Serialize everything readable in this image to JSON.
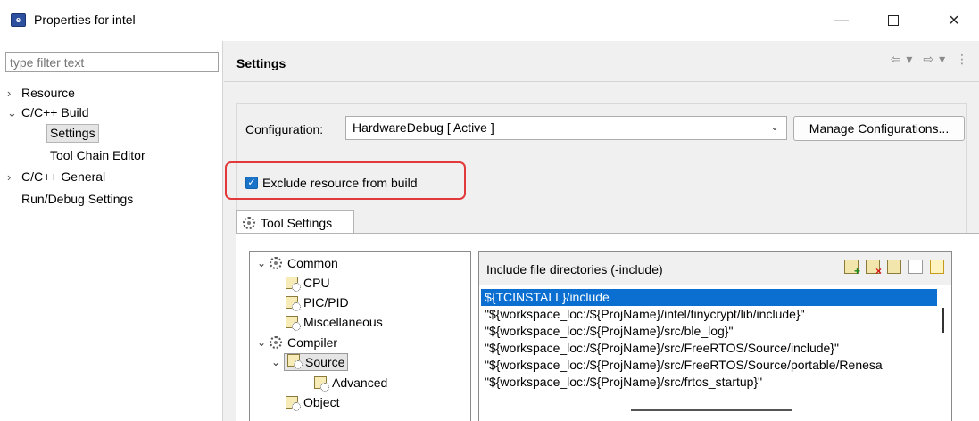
{
  "window": {
    "title": "Properties for intel",
    "icon_label": "e",
    "icon_name": "eclipse-app-icon"
  },
  "sidebar": {
    "filter_placeholder": "type filter text",
    "items": [
      {
        "label": "Resource",
        "arrow": "›",
        "expanded": false
      },
      {
        "label": "C/C++ Build",
        "arrow": "⌄",
        "expanded": true
      },
      {
        "label": "Settings",
        "selected": true
      },
      {
        "label": "Tool Chain Editor"
      },
      {
        "label": "C/C++ General",
        "arrow": "›",
        "expanded": false
      },
      {
        "label": "Run/Debug Settings"
      }
    ]
  },
  "header": {
    "title": "Settings"
  },
  "config": {
    "label": "Configuration:",
    "selected": "HardwareDebug  [ Active ]",
    "manage_label": "Manage Configurations..."
  },
  "exclude": {
    "label": "Exclude resource from build",
    "checked": true,
    "highlight_color": "#e23a3a"
  },
  "tabs": [
    {
      "label": "Tool Settings",
      "active": true
    }
  ],
  "tool_tree": [
    {
      "label": "Common",
      "arrow": "⌄",
      "icon": "gear-icon"
    },
    {
      "label": "CPU",
      "icon": "page-gear-icon"
    },
    {
      "label": "PIC/PID",
      "icon": "page-gear-icon"
    },
    {
      "label": "Miscellaneous",
      "icon": "page-gear-icon"
    },
    {
      "label": "Compiler",
      "arrow": "⌄",
      "icon": "gear-icon"
    },
    {
      "label": "Source",
      "arrow": "⌄",
      "icon": "page-gear-icon",
      "selected": true
    },
    {
      "label": "Advanced",
      "icon": "page-gear-icon"
    },
    {
      "label": "Object",
      "icon": "page-gear-icon"
    }
  ],
  "include": {
    "title": "Include file directories (-include)",
    "items": [
      "${TCINSTALL}/include",
      "\"${workspace_loc:/${ProjName}/intel/tinycrypt/lib/include}\"",
      "\"${workspace_loc:/${ProjName}/src/ble_log}\"",
      "\"${workspace_loc:/${ProjName}/src/FreeRTOS/Source/include}\"",
      "\"${workspace_loc:/${ProjName}/src/FreeRTOS/Source/portable/Renesa",
      "\"${workspace_loc:/${ProjName}/src/frtos_startup}\""
    ],
    "selected_index": 0,
    "selection_color": "#0a6fd1"
  }
}
